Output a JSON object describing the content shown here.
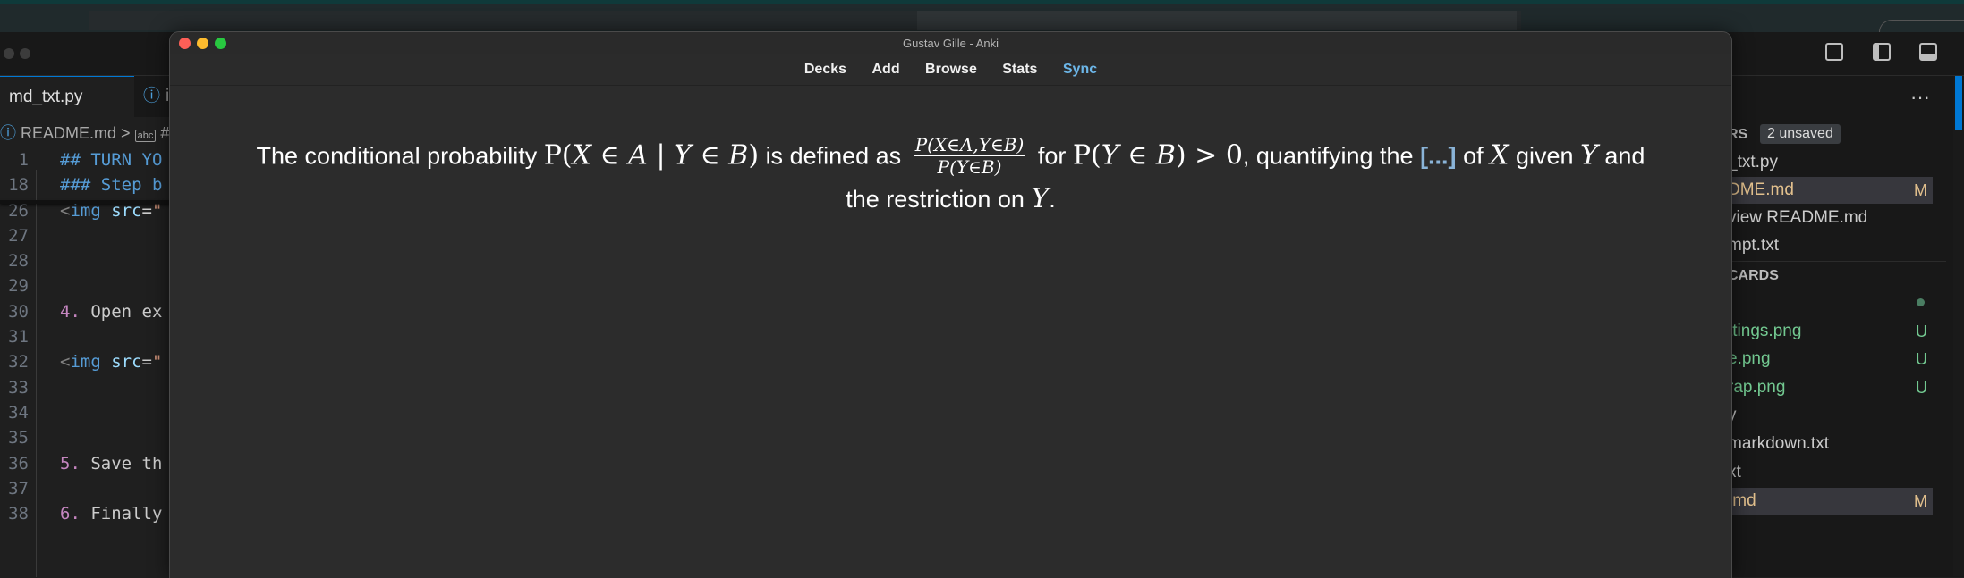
{
  "editor": {
    "tabs": [
      {
        "label": "md_txt.py"
      },
      {
        "label": "i"
      }
    ],
    "breadcrumb": {
      "file": "README.md",
      "sep": ">",
      "symbol_prefix": "#"
    },
    "code_lines": [
      {
        "ln": "1",
        "text": "## TURN YO"
      },
      {
        "ln": "18",
        "text": "### Step b"
      },
      {
        "ln": "26",
        "text": "<img src=\""
      },
      {
        "ln": "27",
        "text": ""
      },
      {
        "ln": "28",
        "text": ""
      },
      {
        "ln": "29",
        "text": ""
      },
      {
        "ln": "30",
        "text": "4. Open ex"
      },
      {
        "ln": "31",
        "text": ""
      },
      {
        "ln": "32",
        "text": "<img src=\""
      },
      {
        "ln": "33",
        "text": ""
      },
      {
        "ln": "34",
        "text": ""
      },
      {
        "ln": "35",
        "text": ""
      },
      {
        "ln": "36",
        "text": "5. Save th"
      },
      {
        "ln": "37",
        "text": ""
      },
      {
        "ln": "38",
        "text": "6. Finally"
      }
    ]
  },
  "right_panel": {
    "ellipsis": "···",
    "open_editors_header": "RS",
    "unsaved_badge": "2 unsaved",
    "items": [
      {
        "label": "_txt.py",
        "badge": ""
      },
      {
        "label": "DME.md",
        "badge": "M"
      },
      {
        "label": "view README.md",
        "badge": ""
      },
      {
        "label": "mpt.txt",
        "badge": ""
      }
    ],
    "section_header": "CARDS",
    "files": [
      {
        "label": "ttings.png",
        "badge": "U"
      },
      {
        "label": "e.png",
        "badge": "U"
      },
      {
        "label": "rap.png",
        "badge": "U"
      },
      {
        "label": "y",
        "badge": ""
      },
      {
        "label": "markdown.txt",
        "badge": ""
      },
      {
        "label": "xt",
        "badge": ""
      },
      {
        "label": ".md",
        "badge": "M"
      }
    ]
  },
  "anki": {
    "window_title": "Gustav Gille - Anki",
    "toolbar": [
      "Decks",
      "Add",
      "Browse",
      "Stats",
      "Sync"
    ],
    "card": {
      "prefix": "The conditional probability",
      "defined_as": "is defined as",
      "frac_num": "P(X∈A,Y∈B)",
      "frac_den": "P(Y∈B)",
      "for_text": "for",
      "quantifying": ", quantifying the",
      "cloze": "[...]",
      "of_text": "of",
      "given_text": "given",
      "and_text": "and",
      "line2": "the restriction on"
    }
  },
  "colors": {
    "sync_link": "#6cb6e8",
    "cloze": "#8ab4d8",
    "close": "#fe5f57",
    "minimize": "#febc2e",
    "maximize": "#28c840",
    "modified": "#e2c08d",
    "untracked": "#73c991"
  }
}
